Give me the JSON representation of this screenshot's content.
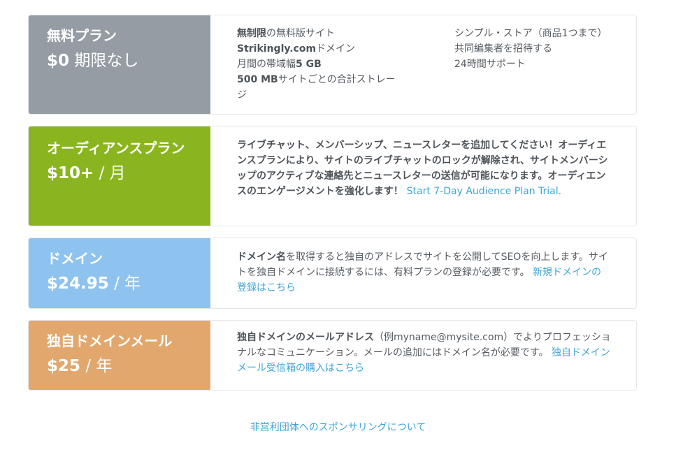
{
  "free_plan": {
    "name": "無料プラン",
    "price_amount": "$0",
    "price_period": "期限なし",
    "features_left": [
      {
        "bold": "無制限",
        "text": "の無料版サイト"
      },
      {
        "bold": "Strikingly.com",
        "text": "ドメイン"
      },
      {
        "bold": "",
        "text": "月間の帯域幅",
        "bold_after": "5 GB"
      },
      {
        "bold": "500 MB",
        "text": "サイトごとの合計ストレージ"
      }
    ],
    "features_right": [
      "シンプル・ストア（商品1つまで）",
      "共同編集者を招待する",
      "24時間サポート"
    ]
  },
  "audience_plan": {
    "name": "オーディアンスプラン",
    "price_amount": "$10+",
    "price_period": "/ 月",
    "description": "ライブチャット、メンバーシップ、ニュースレターを追加してください！オーディエンスプランにより、サイトのライブチャットのロックが解除され、サイトメンバーシップのアクティブな連絡先とニュースレターの送信が可能になります。オーディエンスのエンゲージメントを強化します！",
    "link": "Start 7-Day Audience Plan Trial."
  },
  "domain_plan": {
    "name": "ドメイン",
    "price_amount": "$24.95",
    "price_period": "/ 年",
    "description_bold": "ドメイン名",
    "description": "を取得すると独自のアドレスでサイトを公開してSEOを向上します。サイトを独自ドメインに接続するには、有料プランの登録が必要です。",
    "link": "新規ドメインの登録はこちら"
  },
  "mail_plan": {
    "name": "独自ドメインメール",
    "price_amount": "$25",
    "price_period": "/ 年",
    "description_bold": "独自ドメインのメールアドレス",
    "description": "（例myname@mysite.com）でよりプロフェッショナルなコミュニケーション。メールの追加にはドメイン名が必要です。",
    "link": "独自ドメインメール受信箱の購入はこちら"
  },
  "footer": {
    "sponsor_link": "非営利団体へのスポンサリングについて"
  },
  "colors": {
    "free": "#959ca3",
    "audience": "#8ab51e",
    "domain": "#8fc3ef",
    "mail": "#e2a76d",
    "link": "#3ea5d6"
  }
}
